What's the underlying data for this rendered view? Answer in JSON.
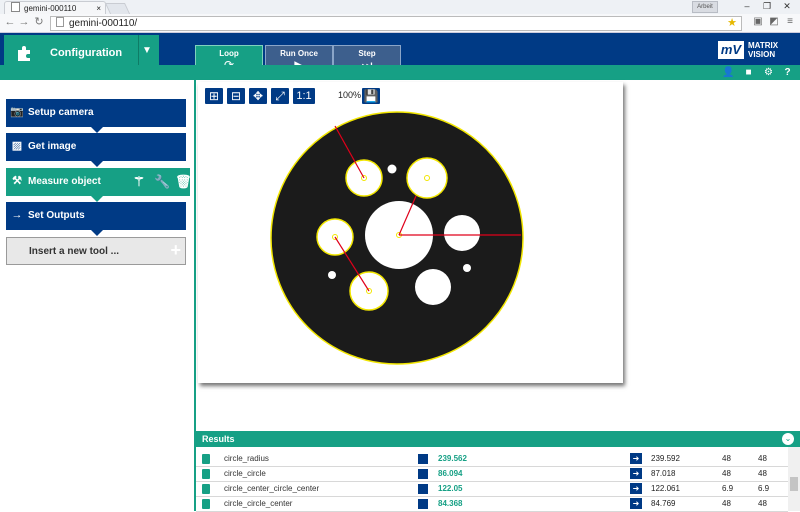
{
  "browser": {
    "tab_title": "gemini-000110",
    "url": "gemini-000110/",
    "user_label": "Arbeit",
    "back_icon": "back-arrow-icon",
    "forward_icon": "forward-arrow-icon",
    "reload_icon": "reload-icon"
  },
  "header": {
    "config_label": "Configuration",
    "run_buttons": [
      {
        "label": "Loop",
        "glyph": "⟳"
      },
      {
        "label": "Run Once",
        "glyph": "▶"
      },
      {
        "label": "Step",
        "glyph": "⏭"
      }
    ],
    "logo_mark": "mV",
    "logo_text_1": "MATRIX",
    "logo_text_2": "VISION"
  },
  "sidebar": {
    "steps": [
      {
        "label": "Setup camera",
        "icon": "camera-icon"
      },
      {
        "label": "Get image",
        "icon": "image-icon"
      },
      {
        "label": "Measure object",
        "icon": "measure-icon"
      },
      {
        "label": "Set Outputs",
        "icon": "arrow-right-icon"
      }
    ],
    "insert_label": "Insert a new tool ...",
    "insert_plus": "+"
  },
  "image_toolbar": {
    "zoom": "100%",
    "one_to_one": "1:1"
  },
  "results": {
    "title": "Results",
    "rows": [
      {
        "name": "circle_radius",
        "value": "239.562",
        "ref": "239.592",
        "min": "48",
        "max": "48"
      },
      {
        "name": "circle_circle",
        "value": "86.094",
        "ref": "87.018",
        "min": "48",
        "max": "48"
      },
      {
        "name": "circle_center_circle_center",
        "value": "122.05",
        "ref": "122.061",
        "min": "6.9",
        "max": "6.9"
      },
      {
        "name": "circle_circle_center",
        "value": "84.368",
        "ref": "84.769",
        "min": "48",
        "max": "48"
      }
    ]
  },
  "colors": {
    "navy": "#003a85",
    "teal": "#16a085",
    "overlay_yellow": "#f2e600",
    "overlay_red": "#e0001a"
  }
}
